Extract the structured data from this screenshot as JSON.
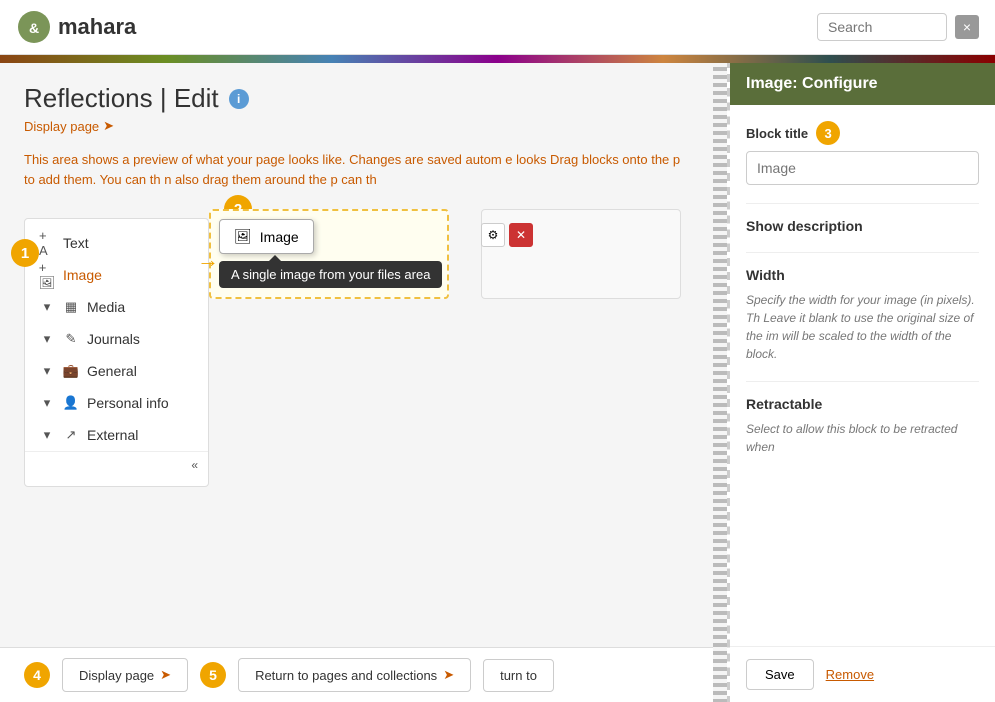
{
  "header": {
    "logo_text": "mahara",
    "search_placeholder": "Search",
    "close_label": "×"
  },
  "page": {
    "title": "Reflections | Edit",
    "display_page_link": "Display page",
    "preview_text": "This area shows a preview of what your page looks like. Changes are saved autom  e looks  Drag blocks onto the p   to add them. You can th  n also drag them around the p  can th"
  },
  "blocks_panel": {
    "items": [
      {
        "label": "Text",
        "icon": "A",
        "has_arrow": false,
        "active": false
      },
      {
        "label": "Image",
        "icon": "🖼",
        "has_arrow": true,
        "active": true
      },
      {
        "label": "Media",
        "icon": "▦",
        "has_arrow": false,
        "active": false
      },
      {
        "label": "Journals",
        "icon": "✎",
        "has_arrow": false,
        "active": false
      },
      {
        "label": "General",
        "icon": "💼",
        "has_arrow": false,
        "active": false
      },
      {
        "label": "Personal info",
        "icon": "👤",
        "has_arrow": false,
        "active": false
      },
      {
        "label": "External",
        "icon": "↗",
        "has_arrow": false,
        "active": false
      }
    ],
    "collapse_label": "«"
  },
  "dragging_block": {
    "label": "Image"
  },
  "tooltip": {
    "text": "A single image from your files area"
  },
  "right_panel": {
    "title": "Image: Configure",
    "step3_label": "3",
    "block_title_label": "Block title",
    "block_title_placeholder": "Image",
    "show_description_label": "Show description",
    "width_label": "Width",
    "width_description": "Specify the width for your image (in pixels). Th Leave it blank to use the original size of the im will be scaled to the width of the block.",
    "retractable_label": "Retractable",
    "retractable_description": "Select to allow this block to be retracted when",
    "save_label": "Save",
    "remove_label": "Remove"
  },
  "bottom_bar": {
    "step4_label": "4",
    "step5_label": "5",
    "display_page_label": "Display page",
    "return_label": "Return to pages and collections",
    "turn_label": "turn to"
  },
  "steps": {
    "step1": "1",
    "step2": "2"
  }
}
